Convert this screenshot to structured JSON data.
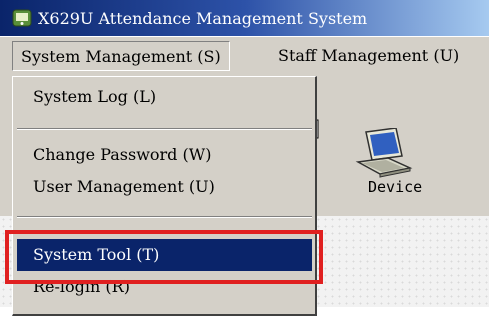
{
  "window": {
    "title": "X629U Attendance Management System",
    "icon": "app-icon"
  },
  "menubar": {
    "items": [
      {
        "label": "System Management (S)"
      },
      {
        "label": "Staff Management (U)"
      }
    ]
  },
  "dropdown": {
    "items": [
      {
        "label": "System Log (L)"
      },
      {
        "label": "Change Password (W)"
      },
      {
        "label": "User Management (U)"
      },
      {
        "label": "System Tool (T)",
        "selected": true
      },
      {
        "label": "Re-login (R)"
      }
    ]
  },
  "toolbar": {
    "device_label": "Device",
    "device_icon": "laptop-icon"
  },
  "colors": {
    "highlight": "#e02020",
    "selection": "#0a246a",
    "menu_bg": "#d4d0c8"
  }
}
